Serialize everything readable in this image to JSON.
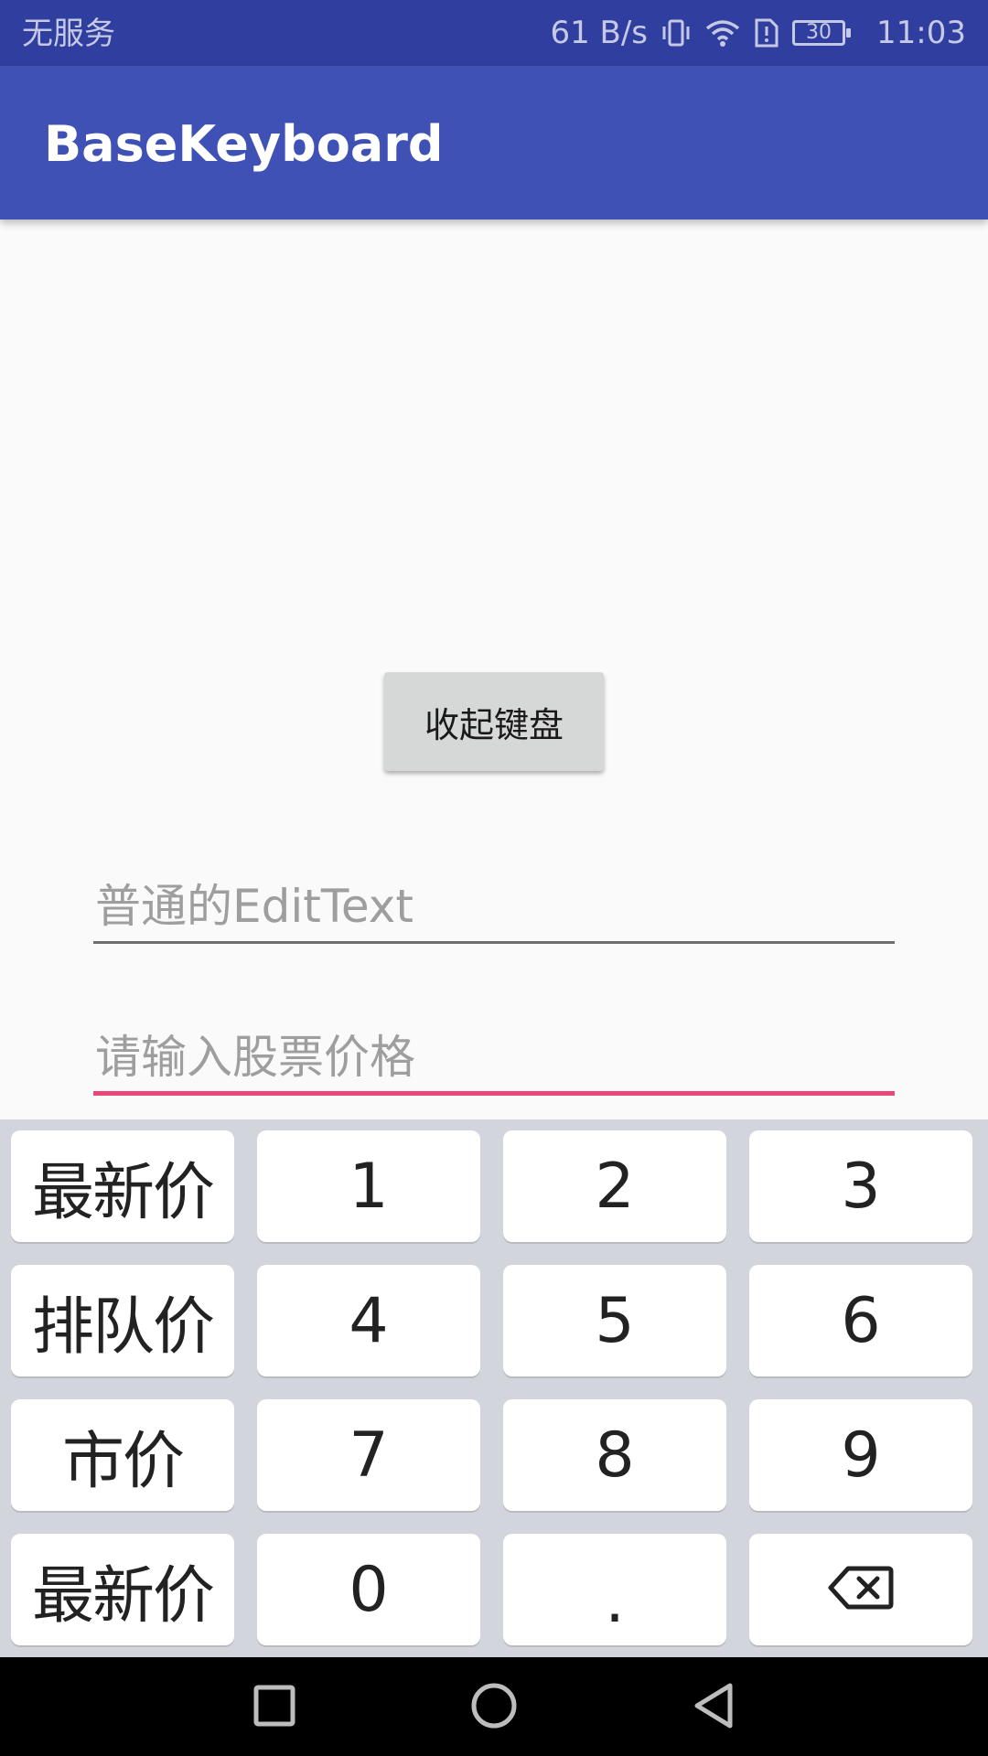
{
  "status_bar": {
    "carrier": "无服务",
    "speed": "61 B/s",
    "battery": "30",
    "time": "11:03",
    "icons": [
      "vibrate-icon",
      "wifi-icon",
      "sim-alert-icon",
      "battery-icon"
    ]
  },
  "app_bar": {
    "title": "BaseKeyboard"
  },
  "content": {
    "collapse_button": "收起键盘",
    "normal_edit_placeholder": "普通的EditText",
    "stock_edit_placeholder": "请输入股票价格"
  },
  "keyboard": {
    "keys": [
      [
        "最新价",
        "1",
        "2",
        "3"
      ],
      [
        "排队价",
        "4",
        "5",
        "6"
      ],
      [
        "市价",
        "7",
        "8",
        "9"
      ],
      [
        "最新价",
        "0",
        ".",
        ""
      ]
    ],
    "delete_icon": "backspace-icon"
  },
  "nav_bar": {
    "icons": [
      "recent-apps-icon",
      "home-icon",
      "back-icon"
    ]
  },
  "colors": {
    "status_bar": "#303f9f",
    "app_bar": "#3f51b5",
    "accent": "#e94777",
    "keyboard_bg": "#d2d5db"
  }
}
